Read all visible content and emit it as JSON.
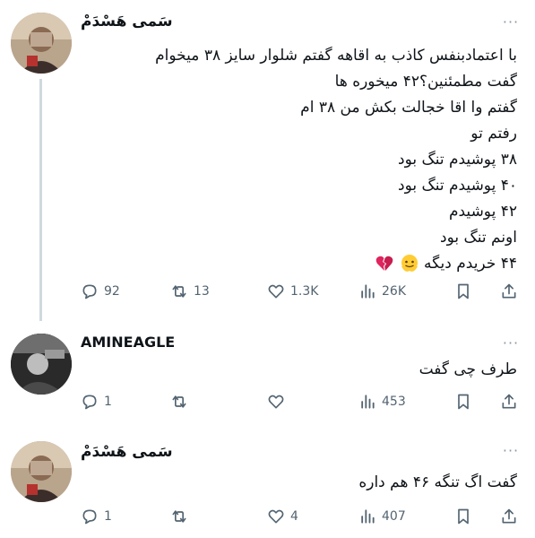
{
  "tweets": [
    {
      "author": "سَمی هَسْدَمْ",
      "lines": [
        "با اعتمادبنفس کاذب به اقاهه گفتم شلوار سایز ۳۸ میخوام",
        "گفت مطمئنین؟۴۲ میخوره ها",
        "گفتم وا اقا خجالت بکش من ۳۸ ام",
        "رفتم تو",
        "۳۸ پوشیدم تنگ بود",
        "۴۰ پوشیدم تنگ بود",
        "۴۲ پوشیدم",
        "اونم تنگ بود",
        "۴۴ خریدم دیگه"
      ],
      "emojis": [
        "melting-face-emoji",
        "broken-heart-emoji"
      ],
      "replies": "92",
      "retweets": "13",
      "likes": "1.3K",
      "views": "26K"
    },
    {
      "author": "AMINEAGLE",
      "lines": [
        "طرف چی گفت"
      ],
      "replies": "1",
      "retweets": "",
      "likes": "",
      "views": "453"
    },
    {
      "author": "سَمی هَسْدَمْ",
      "lines": [
        "گفت اگ تنگه ۴۶ هم داره"
      ],
      "replies": "1",
      "retweets": "",
      "likes": "4",
      "views": "407"
    }
  ],
  "more_glyph": "···",
  "colors": {
    "text": "#0f1419",
    "muted": "#536471",
    "thread": "#cfd9de",
    "heart_red": "#e0245e",
    "emoji_yellow": "#ffcc33"
  }
}
